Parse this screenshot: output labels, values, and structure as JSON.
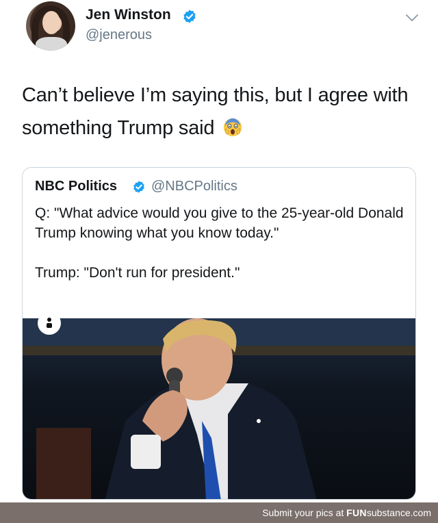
{
  "tweet": {
    "author": {
      "display_name": "Jen Winston",
      "handle": "@jenerous",
      "verified": true
    },
    "text": "Can’t believe I’m saying this, but I agree with something Trump said",
    "emoji": "screaming-face"
  },
  "quoted_tweet": {
    "author": {
      "display_name": "NBC Politics",
      "handle": "@NBCPolitics",
      "verified": true
    },
    "paragraph_1": "Q: \"What advice would you give to the 25-year-old Donald Trump knowing what you know today.\"",
    "paragraph_2": "Trump: \"Don't run for president.\""
  },
  "watermark": {
    "prefix": "Submit your pics at ",
    "brand_bold": "FUN",
    "brand_rest": "substance",
    "suffix": ".com"
  },
  "colors": {
    "verified_blue": "#1da1f2",
    "secondary_text": "#657786",
    "card_border": "#ccd6dd",
    "footer_bg": "#7a6f6a"
  },
  "icons": {
    "verified": "verified-badge-icon",
    "menu": "chevron-down-icon",
    "emoji": "screaming-face-emoji-icon",
    "user": "user-icon"
  }
}
